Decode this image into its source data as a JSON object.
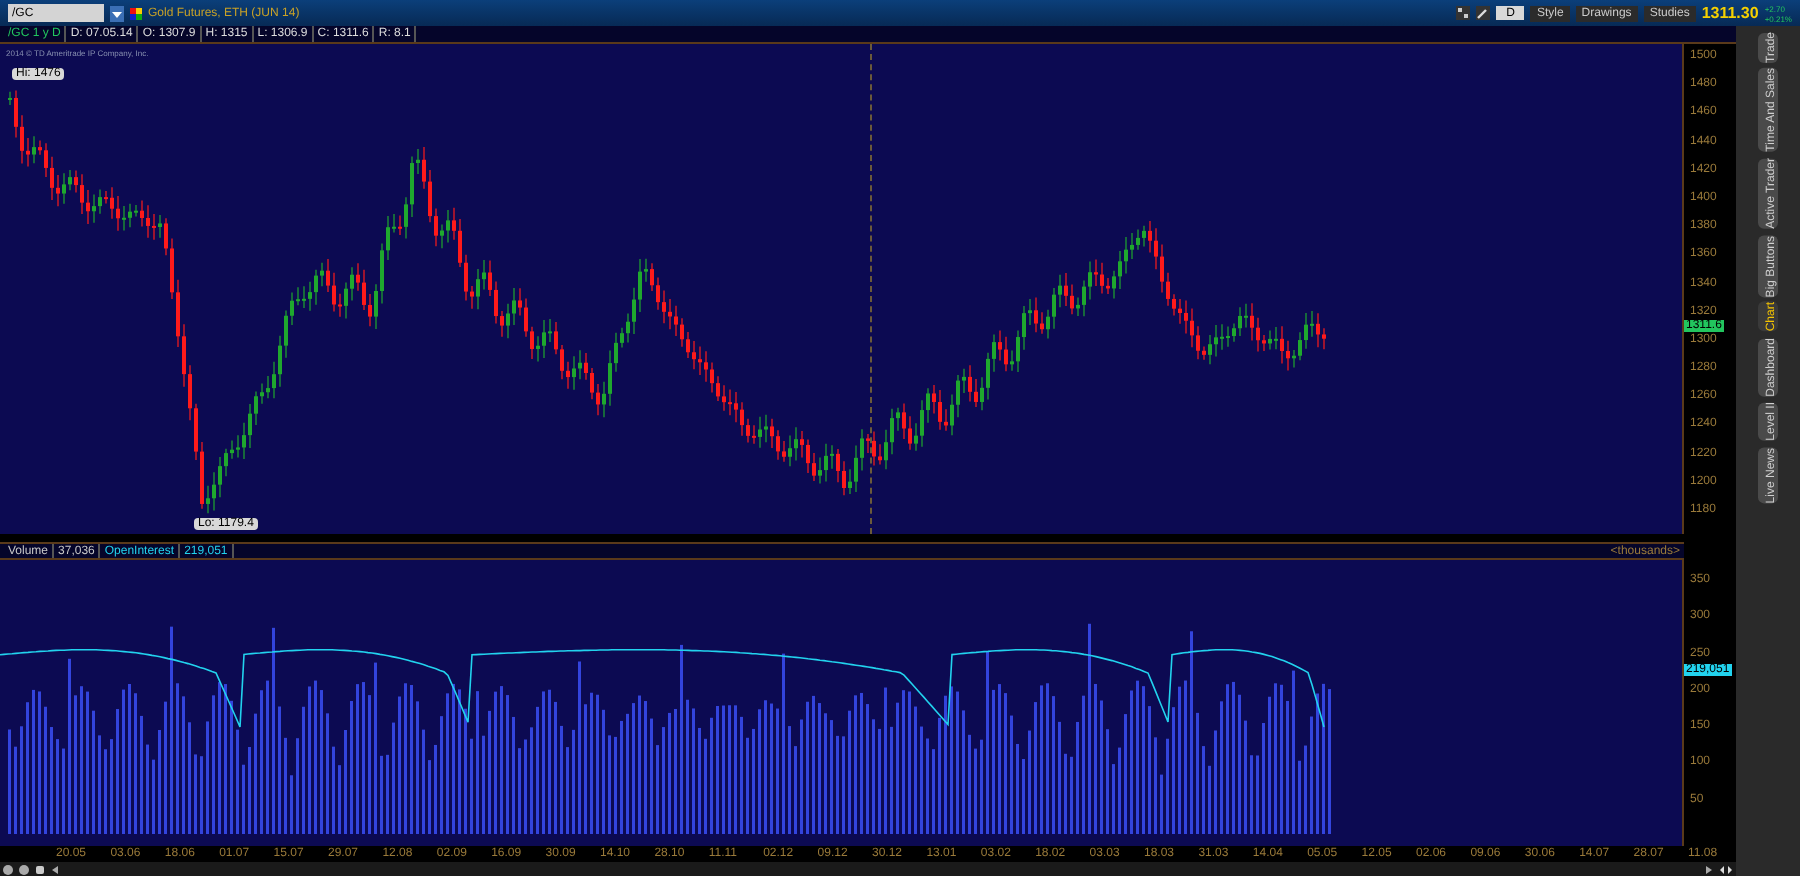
{
  "toolbar": {
    "symbol": "/GC",
    "description": "Gold Futures, ETH (JUN 14)",
    "period_button": "D",
    "buttons": [
      "Style",
      "Drawings",
      "Studies"
    ],
    "last_price": "1311.30",
    "change": "+2.70",
    "change_percent": "+0.21%"
  },
  "info_bar": [
    "/GC 1 y D",
    "D: 07.05.14",
    "O: 1307.9",
    "H: 1315",
    "L: 1306.9",
    "C: 1311.6",
    "R: 8.1"
  ],
  "copyright": "2014 © TD Ameritrade IP Company, Inc.",
  "price_chart": {
    "high_label": "Hi: 1476",
    "low_label": "Lo: 1179.4",
    "current_marker": "1311.6",
    "price_ticks": [
      "1500",
      "1480",
      "1460",
      "1440",
      "1420",
      "1400",
      "1380",
      "1360",
      "1340",
      "1320",
      "1300",
      "1280",
      "1260",
      "1240",
      "1220",
      "1200",
      "1180"
    ]
  },
  "volume_panel": {
    "labels": [
      {
        "text": "Volume",
        "kind": "name"
      },
      {
        "text": "37,036",
        "kind": "value"
      },
      {
        "text": "OpenInterest",
        "kind": "oi-name"
      },
      {
        "text": "219,051",
        "kind": "oi-value"
      }
    ],
    "units": "<thousands>",
    "current_marker": "219,051",
    "ticks": [
      "350",
      "300",
      "250",
      "200",
      "150",
      "100",
      "50"
    ]
  },
  "time_axis": [
    "20.05",
    "03.06",
    "18.06",
    "01.07",
    "15.07",
    "29.07",
    "12.08",
    "02.09",
    "16.09",
    "30.09",
    "14.10",
    "28.10",
    "11.11",
    "02.12",
    "09.12",
    "30.12",
    "13.01",
    "03.02",
    "18.02",
    "03.03",
    "18.03",
    "31.03",
    "14.04",
    "05.05",
    "12.05",
    "02.06",
    "09.06",
    "30.06",
    "14.07",
    "28.07",
    "11.08"
  ],
  "side_tabs": [
    {
      "label": "Trade",
      "selected": false
    },
    {
      "label": "Time And Sales",
      "selected": false
    },
    {
      "label": "Active Trader",
      "selected": false
    },
    {
      "label": "Big Buttons",
      "selected": false
    },
    {
      "label": "Chart",
      "selected": true
    },
    {
      "label": "Dashboard",
      "selected": false
    },
    {
      "label": "Level II",
      "selected": false
    },
    {
      "label": "Live News",
      "selected": false
    }
  ]
}
